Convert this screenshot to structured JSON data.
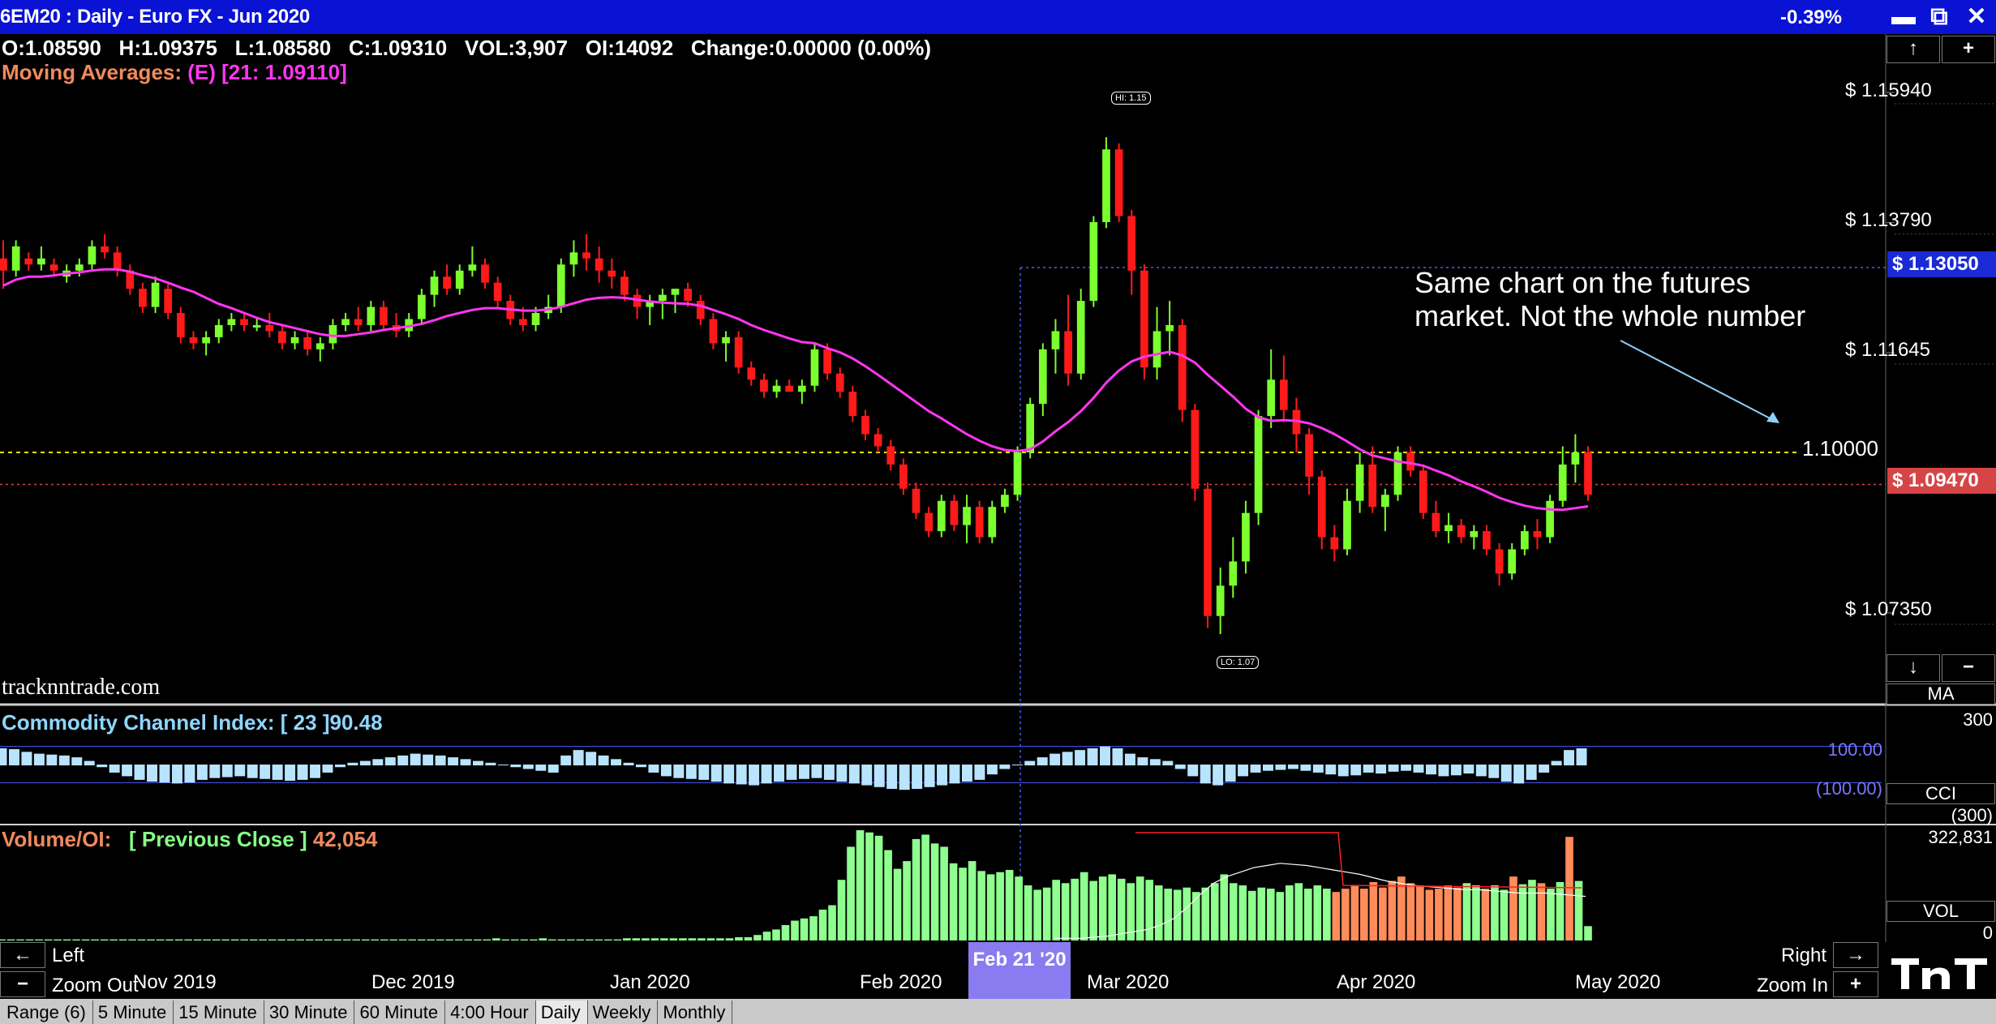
{
  "window": {
    "title": "6EM20 : Daily  -  Euro FX - Jun 2020",
    "change_pct": "-0.39%",
    "minimize": "▬",
    "restore": "⧉",
    "close": "✕"
  },
  "ohlc_line": "O:1.08590   H:1.09375   L:1.08580   C:1.09310   VOL:3,907   OI:14092   Change:0.00000 (0.00%)",
  "moving_averages": {
    "label": "Moving Averages:",
    "value": "(E) [21: 1.09110]",
    "color": "#ff36f0"
  },
  "watermark": "tracknntrade.com",
  "annotation": {
    "line1": "Same chart on the futures",
    "line2": "market. Not the whole number"
  },
  "price_axis": {
    "labels": [
      "$ 1.15940",
      "$ 1.13790",
      "$ 1.11645",
      "$ 1.07350"
    ],
    "current_price": "$ 1.13050",
    "close_price": "$ 1.09470",
    "hline_label": "1.10000",
    "colors": {
      "current_bg": "#1a2ad4",
      "close_bg": "#d64545",
      "hline": "#ffe000"
    }
  },
  "hi_lo": {
    "hi": "HI: 1.15",
    "lo": "LO: 1.07"
  },
  "side_buttons": {
    "up": "↑",
    "plus": "+",
    "down": "↓",
    "minus": "−",
    "ma": "MA"
  },
  "cci": {
    "label": "Commodity Channel Index:  [ 23 ]90.48",
    "axis_top": "300",
    "level_upper": "100.00",
    "level_lower": "(100.00)",
    "name": "CCI",
    "axis_bottom": "(300)"
  },
  "volume": {
    "label_a": "Volume/OI:",
    "label_b": "[ Previous Close ]",
    "label_c": "42,054",
    "axis_top": "322,831",
    "name": "VOL",
    "axis_bottom": "0"
  },
  "navigation": {
    "left_arrow": "←",
    "left": "Left",
    "zoom_out_btn": "−",
    "zoom_out": "Zoom Out",
    "right": "Right",
    "right_arrow": "→",
    "zoom_in": "Zoom In",
    "zoom_in_btn": "+",
    "cursor_date": "Feb 21 '20",
    "months": [
      "Nov 2019",
      "Dec 2019",
      "Jan 2020",
      "Feb 2020",
      "Mar 2020",
      "Apr 2020",
      "May 2020"
    ]
  },
  "tabs": [
    "Range (6)",
    "5 Minute",
    "15 Minute",
    "30 Minute",
    "60 Minute",
    "4:00 Hour",
    "Daily",
    "Weekly",
    "Monthly"
  ],
  "active_tab": "Daily",
  "chart_data": {
    "type": "candlestick",
    "title": "6EM20 : Daily  -  Euro FX - Jun 2020",
    "ylim": [
      1.069,
      1.166
    ],
    "hline": 1.1,
    "current_price_line": 1.1305,
    "close_line": 1.0947,
    "colors": {
      "up": "#7cff2e",
      "down": "#ff1a1a",
      "ma": "#ff36f0"
    },
    "x_labels": [
      "Nov 2019",
      "Dec 2019",
      "Jan 2020",
      "Feb 2020",
      "Mar 2020",
      "Apr 2020",
      "May 2020"
    ],
    "candles": [
      [
        1.132,
        1.135,
        1.127,
        1.13
      ],
      [
        1.13,
        1.135,
        1.129,
        1.134
      ],
      [
        1.132,
        1.133,
        1.13,
        1.131
      ],
      [
        1.131,
        1.134,
        1.13,
        1.132
      ],
      [
        1.131,
        1.132,
        1.129,
        1.13
      ],
      [
        1.129,
        1.131,
        1.128,
        1.13
      ],
      [
        1.13,
        1.132,
        1.129,
        1.131
      ],
      [
        1.131,
        1.135,
        1.13,
        1.134
      ],
      [
        1.134,
        1.136,
        1.132,
        1.133
      ],
      [
        1.133,
        1.134,
        1.129,
        1.13
      ],
      [
        1.13,
        1.131,
        1.126,
        1.127
      ],
      [
        1.127,
        1.128,
        1.123,
        1.124
      ],
      [
        1.124,
        1.129,
        1.123,
        1.128
      ],
      [
        1.127,
        1.128,
        1.122,
        1.123
      ],
      [
        1.123,
        1.124,
        1.118,
        1.119
      ],
      [
        1.119,
        1.12,
        1.117,
        1.118
      ],
      [
        1.118,
        1.12,
        1.116,
        1.119
      ],
      [
        1.119,
        1.122,
        1.118,
        1.121
      ],
      [
        1.121,
        1.123,
        1.12,
        1.122
      ],
      [
        1.122,
        1.123,
        1.12,
        1.121
      ],
      [
        1.121,
        1.122,
        1.12,
        1.121
      ],
      [
        1.121,
        1.123,
        1.119,
        1.12
      ],
      [
        1.12,
        1.121,
        1.117,
        1.118
      ],
      [
        1.118,
        1.12,
        1.117,
        1.119
      ],
      [
        1.119,
        1.12,
        1.116,
        1.117
      ],
      [
        1.117,
        1.119,
        1.115,
        1.118
      ],
      [
        1.118,
        1.122,
        1.117,
        1.121
      ],
      [
        1.121,
        1.123,
        1.12,
        1.122
      ],
      [
        1.122,
        1.124,
        1.12,
        1.121
      ],
      [
        1.121,
        1.125,
        1.12,
        1.124
      ],
      [
        1.124,
        1.125,
        1.12,
        1.121
      ],
      [
        1.121,
        1.123,
        1.119,
        1.12
      ],
      [
        1.12,
        1.123,
        1.119,
        1.122
      ],
      [
        1.122,
        1.127,
        1.121,
        1.126
      ],
      [
        1.126,
        1.13,
        1.124,
        1.129
      ],
      [
        1.129,
        1.131,
        1.126,
        1.127
      ],
      [
        1.127,
        1.131,
        1.126,
        1.13
      ],
      [
        1.13,
        1.134,
        1.129,
        1.131
      ],
      [
        1.131,
        1.132,
        1.127,
        1.128
      ],
      [
        1.128,
        1.129,
        1.124,
        1.125
      ],
      [
        1.125,
        1.126,
        1.121,
        1.122
      ],
      [
        1.122,
        1.124,
        1.12,
        1.121
      ],
      [
        1.121,
        1.124,
        1.12,
        1.123
      ],
      [
        1.123,
        1.126,
        1.122,
        1.124
      ],
      [
        1.124,
        1.132,
        1.123,
        1.131
      ],
      [
        1.131,
        1.135,
        1.129,
        1.133
      ],
      [
        1.133,
        1.136,
        1.13,
        1.132
      ],
      [
        1.132,
        1.134,
        1.128,
        1.13
      ],
      [
        1.13,
        1.132,
        1.127,
        1.129
      ],
      [
        1.129,
        1.13,
        1.125,
        1.126
      ],
      [
        1.126,
        1.127,
        1.122,
        1.124
      ],
      [
        1.124,
        1.126,
        1.121,
        1.125
      ],
      [
        1.125,
        1.127,
        1.122,
        1.126
      ],
      [
        1.126,
        1.127,
        1.123,
        1.127
      ],
      [
        1.127,
        1.128,
        1.124,
        1.125
      ],
      [
        1.125,
        1.126,
        1.121,
        1.122
      ],
      [
        1.122,
        1.123,
        1.117,
        1.118
      ],
      [
        1.118,
        1.12,
        1.115,
        1.119
      ],
      [
        1.119,
        1.12,
        1.113,
        1.114
      ],
      [
        1.114,
        1.115,
        1.111,
        1.112
      ],
      [
        1.112,
        1.113,
        1.109,
        1.11
      ],
      [
        1.11,
        1.112,
        1.109,
        1.111
      ],
      [
        1.111,
        1.112,
        1.11,
        1.11
      ],
      [
        1.11,
        1.112,
        1.108,
        1.111
      ],
      [
        1.111,
        1.118,
        1.11,
        1.117
      ],
      [
        1.117,
        1.118,
        1.112,
        1.113
      ],
      [
        1.113,
        1.114,
        1.109,
        1.11
      ],
      [
        1.11,
        1.111,
        1.105,
        1.106
      ],
      [
        1.106,
        1.107,
        1.102,
        1.103
      ],
      [
        1.103,
        1.104,
        1.1,
        1.101
      ],
      [
        1.101,
        1.102,
        1.097,
        1.098
      ],
      [
        1.098,
        1.099,
        1.093,
        1.094
      ],
      [
        1.094,
        1.095,
        1.089,
        1.09
      ],
      [
        1.09,
        1.091,
        1.086,
        1.087
      ],
      [
        1.087,
        1.093,
        1.086,
        1.092
      ],
      [
        1.092,
        1.093,
        1.087,
        1.088
      ],
      [
        1.088,
        1.093,
        1.085,
        1.091
      ],
      [
        1.091,
        1.092,
        1.085,
        1.086
      ],
      [
        1.086,
        1.092,
        1.085,
        1.091
      ],
      [
        1.091,
        1.094,
        1.09,
        1.093
      ],
      [
        1.093,
        1.101,
        1.092,
        1.1
      ],
      [
        1.1,
        1.109,
        1.099,
        1.108
      ],
      [
        1.108,
        1.118,
        1.106,
        1.117
      ],
      [
        1.117,
        1.122,
        1.113,
        1.12
      ],
      [
        1.12,
        1.126,
        1.111,
        1.113
      ],
      [
        1.113,
        1.127,
        1.112,
        1.125
      ],
      [
        1.125,
        1.139,
        1.124,
        1.138
      ],
      [
        1.138,
        1.152,
        1.137,
        1.15
      ],
      [
        1.15,
        1.151,
        1.138,
        1.139
      ],
      [
        1.139,
        1.14,
        1.126,
        1.13
      ],
      [
        1.13,
        1.131,
        1.112,
        1.114
      ],
      [
        1.114,
        1.124,
        1.112,
        1.12
      ],
      [
        1.12,
        1.125,
        1.116,
        1.121
      ],
      [
        1.121,
        1.122,
        1.105,
        1.107
      ],
      [
        1.107,
        1.108,
        1.092,
        1.094
      ],
      [
        1.094,
        1.095,
        1.071,
        1.073
      ],
      [
        1.073,
        1.081,
        1.07,
        1.078
      ],
      [
        1.078,
        1.086,
        1.076,
        1.082
      ],
      [
        1.082,
        1.092,
        1.08,
        1.09
      ],
      [
        1.09,
        1.107,
        1.088,
        1.106
      ],
      [
        1.106,
        1.117,
        1.104,
        1.112
      ],
      [
        1.112,
        1.116,
        1.105,
        1.107
      ],
      [
        1.107,
        1.109,
        1.1,
        1.103
      ],
      [
        1.103,
        1.104,
        1.093,
        1.096
      ],
      [
        1.096,
        1.097,
        1.084,
        1.086
      ],
      [
        1.086,
        1.088,
        1.082,
        1.084
      ],
      [
        1.084,
        1.094,
        1.083,
        1.092
      ],
      [
        1.092,
        1.1,
        1.09,
        1.098
      ],
      [
        1.098,
        1.101,
        1.09,
        1.091
      ],
      [
        1.091,
        1.094,
        1.087,
        1.093
      ],
      [
        1.093,
        1.101,
        1.092,
        1.1
      ],
      [
        1.1,
        1.101,
        1.096,
        1.097
      ],
      [
        1.097,
        1.098,
        1.089,
        1.09
      ],
      [
        1.09,
        1.092,
        1.086,
        1.087
      ],
      [
        1.087,
        1.09,
        1.085,
        1.088
      ],
      [
        1.088,
        1.089,
        1.085,
        1.086
      ],
      [
        1.086,
        1.088,
        1.084,
        1.087
      ],
      [
        1.087,
        1.088,
        1.083,
        1.084
      ],
      [
        1.084,
        1.085,
        1.078,
        1.08
      ],
      [
        1.08,
        1.085,
        1.079,
        1.084
      ],
      [
        1.084,
        1.088,
        1.083,
        1.087
      ],
      [
        1.087,
        1.089,
        1.084,
        1.086
      ],
      [
        1.086,
        1.093,
        1.085,
        1.092
      ],
      [
        1.092,
        1.101,
        1.091,
        1.098
      ],
      [
        1.098,
        1.103,
        1.095,
        1.1
      ],
      [
        1.1,
        1.101,
        1.092,
        1.093
      ]
    ],
    "ma_21": [
      1.1275,
      1.1285,
      1.129,
      1.129,
      1.1292,
      1.1295,
      1.1297,
      1.13,
      1.1302,
      1.1302,
      1.1298,
      1.1292,
      1.1287,
      1.128,
      1.1272,
      1.1265,
      1.1255,
      1.1245,
      1.1238,
      1.123,
      1.1222,
      1.1215,
      1.121,
      1.1205,
      1.12,
      1.1195,
      1.1192,
      1.1192,
      1.1195,
      1.1198,
      1.1202,
      1.1205,
      1.1208,
      1.1212,
      1.1218,
      1.1225,
      1.123,
      1.1235,
      1.1238,
      1.1238,
      1.1236,
      1.1234,
      1.1234,
      1.1236,
      1.124,
      1.1246,
      1.1252,
      1.1255,
      1.1256,
      1.1255,
      1.1252,
      1.1249,
      1.1247,
      1.1246,
      1.1245,
      1.1242,
      1.1235,
      1.1228,
      1.122,
      1.121,
      1.1202,
      1.1195,
      1.1188,
      1.1182,
      1.118,
      1.1172,
      1.1165,
      1.1155,
      1.1142,
      1.1128,
      1.1113,
      1.1098,
      1.1083,
      1.1068,
      1.1056,
      1.1043,
      1.103,
      1.1019,
      1.101,
      1.1004,
      1.1002,
      1.1005,
      1.1018,
      1.1035,
      1.105,
      1.1068,
      1.109,
      1.1115,
      1.1135,
      1.115,
      1.1158,
      1.1162,
      1.1166,
      1.116,
      1.1148,
      1.1128,
      1.111,
      1.1092,
      1.1072,
      1.1058,
      1.1052,
      1.1053,
      1.1052,
      1.1048,
      1.104,
      1.103,
      1.1018,
      1.1005,
      1.0995,
      1.099,
      1.0985,
      1.0982,
      1.0978,
      1.097,
      1.0962,
      1.0952,
      1.0944,
      1.0935,
      1.0925,
      1.0918,
      1.0912,
      1.0908,
      1.0906,
      1.0905,
      1.0908,
      1.0911
    ],
    "cci_values": [
      90,
      85,
      70,
      60,
      55,
      50,
      40,
      20,
      -10,
      -40,
      -60,
      -80,
      -90,
      -95,
      -100,
      -95,
      -80,
      -70,
      -65,
      -60,
      -70,
      -75,
      -80,
      -85,
      -80,
      -70,
      -40,
      -10,
      10,
      20,
      30,
      40,
      50,
      60,
      55,
      50,
      40,
      30,
      20,
      10,
      0,
      -10,
      -20,
      -30,
      -40,
      50,
      80,
      70,
      50,
      30,
      10,
      -10,
      -40,
      -60,
      -70,
      -75,
      -80,
      -90,
      -100,
      -105,
      -110,
      -100,
      -90,
      -80,
      -75,
      -70,
      -80,
      -90,
      -100,
      -110,
      -120,
      -130,
      -135,
      -130,
      -120,
      -110,
      -100,
      -90,
      -80,
      -50,
      -20,
      0,
      20,
      40,
      60,
      70,
      80,
      90,
      100,
      90,
      60,
      40,
      30,
      20,
      -20,
      -60,
      -100,
      -110,
      -90,
      -60,
      -40,
      -30,
      -25,
      -20,
      -30,
      -40,
      -50,
      -60,
      -55,
      -40,
      -45,
      -35,
      -30,
      -40,
      -50,
      -60,
      -55,
      -45,
      -60,
      -70,
      -90,
      -100,
      -80,
      -40,
      20,
      80,
      90
    ],
    "volume_values": [
      0.01,
      0.01,
      0.01,
      0.01,
      0.01,
      0.01,
      0.01,
      0.01,
      0.01,
      0.01,
      0.01,
      0.01,
      0.01,
      0.01,
      0.01,
      0.01,
      0.01,
      0.01,
      0.01,
      0.01,
      0.01,
      0.01,
      0.01,
      0.01,
      0.01,
      0.01,
      0.01,
      0.01,
      0.01,
      0.01,
      0.01,
      0.01,
      0.01,
      0.01,
      0.01,
      0.01,
      0.01,
      0.01,
      0.01,
      0.01,
      0.01,
      0.01,
      0.01,
      0.01,
      0.01,
      0.01,
      0.01,
      0.01,
      0.01,
      0.01,
      0.01,
      0.01,
      0.01,
      0.02,
      0.01,
      0.01,
      0.01,
      0.01,
      0.02,
      0.01,
      0.01,
      0.01,
      0.01,
      0.01,
      0.01,
      0.01,
      0.01,
      0.02,
      0.02,
      0.02,
      0.02,
      0.02,
      0.02,
      0.02,
      0.02,
      0.02,
      0.02,
      0.02,
      0.02,
      0.03,
      0.03,
      0.05,
      0.08,
      0.1,
      0.14,
      0.18,
      0.2,
      0.22,
      0.28,
      0.32,
      0.55,
      0.85,
      1.0,
      0.98,
      0.95,
      0.82,
      0.65,
      0.72,
      0.92,
      0.96,
      0.88,
      0.85,
      0.7,
      0.66,
      0.72,
      0.63,
      0.6,
      0.62,
      0.64,
      0.58,
      0.5,
      0.46,
      0.48,
      0.55,
      0.52,
      0.56,
      0.62,
      0.54,
      0.58,
      0.6,
      0.56,
      0.52,
      0.58,
      0.55,
      0.5,
      0.47,
      0.46,
      0.48,
      0.44,
      0.48,
      0.52,
      0.6,
      0.52,
      0.5,
      0.45,
      0.48,
      0.47,
      0.44,
      0.5,
      0.52,
      0.47,
      0.5,
      0.47,
      0.44,
      0.47,
      0.5,
      0.47,
      0.53,
      0.48,
      0.54,
      0.58,
      0.52,
      0.5,
      0.46,
      0.47,
      0.5,
      0.48,
      0.52,
      0.5,
      0.47,
      0.5,
      0.46,
      0.58,
      0.51,
      0.55,
      0.52,
      0.47,
      0.53,
      0.94,
      0.54,
      0.13
    ],
    "open_interest_values": [
      0.02,
      0.02,
      0.02,
      0.03,
      0.04,
      0.06,
      0.08,
      0.1,
      0.14,
      0.2,
      0.3,
      0.42,
      0.52,
      0.58,
      0.62,
      0.66,
      0.68,
      0.7,
      0.69,
      0.68,
      0.66,
      0.64,
      0.62,
      0.6,
      0.57,
      0.54,
      0.52,
      0.5,
      0.49,
      0.48,
      0.47,
      0.46,
      0.46,
      0.45,
      0.44,
      0.43,
      0.43,
      0.43,
      0.42,
      0.41,
      0.4
    ]
  }
}
